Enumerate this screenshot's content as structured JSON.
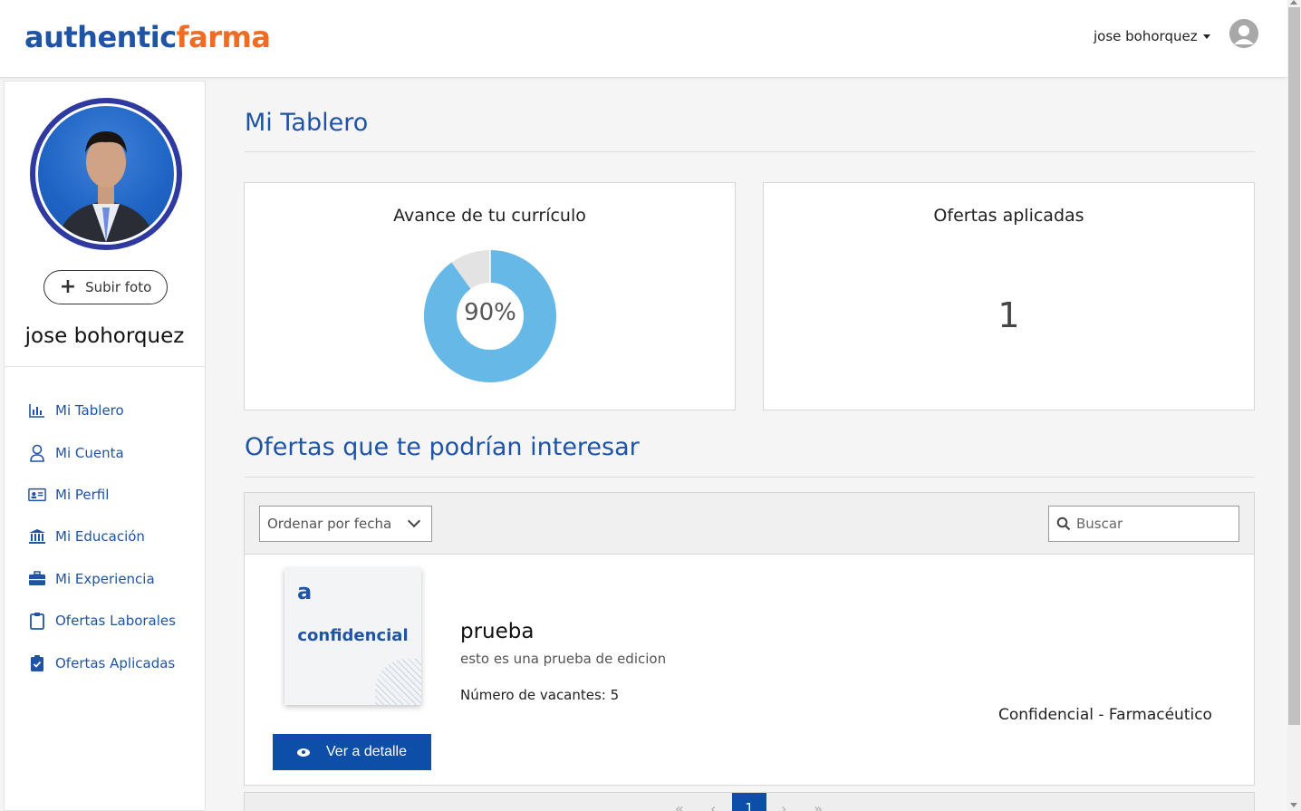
{
  "header": {
    "logo_part1": "authentic",
    "logo_part2": "farma",
    "user_name": "jose bohorquez"
  },
  "sidebar": {
    "upload_label": "Subir foto",
    "profile_name": "jose bohorquez",
    "items": [
      {
        "label": "Mi Tablero",
        "icon": "bar-chart-icon"
      },
      {
        "label": "Mi Cuenta",
        "icon": "user-icon"
      },
      {
        "label": "Mi Perfil",
        "icon": "id-card-icon"
      },
      {
        "label": "Mi Educación",
        "icon": "university-icon"
      },
      {
        "label": "Mi Experiencia",
        "icon": "briefcase-icon"
      },
      {
        "label": "Ofertas Laborales",
        "icon": "clipboard-icon"
      },
      {
        "label": "Ofertas Aplicadas",
        "icon": "clipboard-check-icon"
      }
    ]
  },
  "main": {
    "page_title": "Mi Tablero",
    "progress_card": {
      "title": "Avance de tu currículo",
      "percent": 90,
      "percent_label": "90%",
      "fill_color": "#66b8e6",
      "track_color": "#e3e3e3"
    },
    "applied_card": {
      "title": "Ofertas aplicadas",
      "count": "1"
    },
    "section_title": "Ofertas que te podrían interesar",
    "toolbar": {
      "sort_value": "Ordenar por fecha",
      "search_placeholder": "Buscar"
    },
    "offer": {
      "logo_letter": "a",
      "logo_text": "confidencial",
      "title": "prueba",
      "description": "esto es una prueba de edicion",
      "vacancies": "Número de vacantes: 5",
      "company": "Confidencial - Farmacéutico",
      "detail_button": "Ver a detalle"
    },
    "pagination": {
      "first": "«",
      "prev": "‹",
      "current": "1",
      "next": "›",
      "last": "»"
    }
  },
  "colors": {
    "brand_blue": "#1f54a5",
    "brand_orange": "#ef6c24",
    "button_blue": "#0d4fa8"
  }
}
